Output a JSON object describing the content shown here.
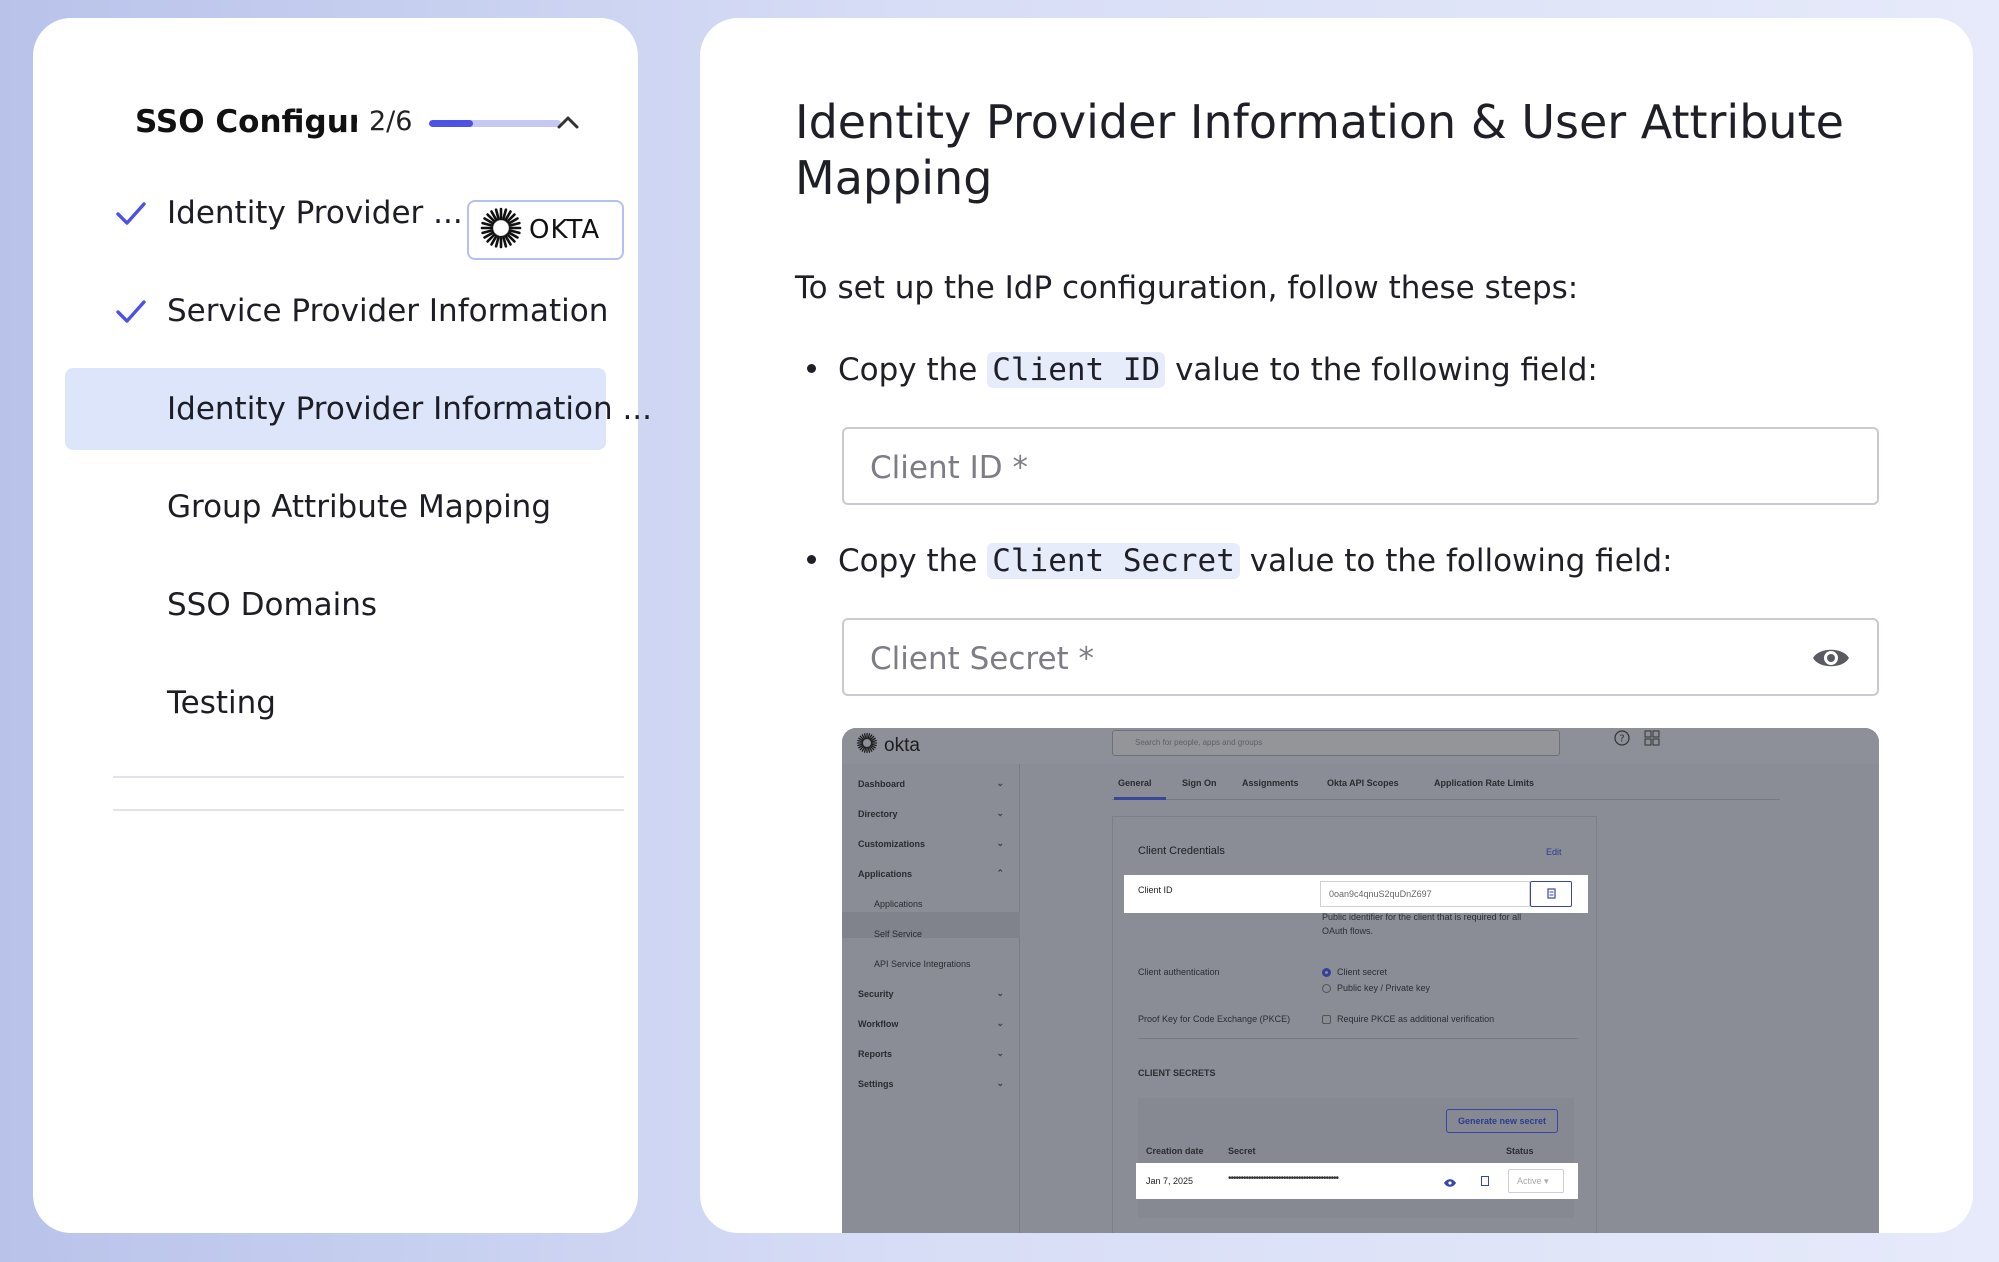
{
  "sidebar": {
    "title": "SSO Configuration",
    "progress_text": "2/6",
    "progress_fraction": 0.33,
    "steps": [
      {
        "label": "Identity Provider ...",
        "completed": true
      },
      {
        "label": "Service Provider Information",
        "completed": true
      },
      {
        "label": "Identity Provider Information ...",
        "completed": false,
        "active": true
      },
      {
        "label": "Group Attribute Mapping",
        "completed": false
      },
      {
        "label": "SSO Domains",
        "completed": false
      },
      {
        "label": "Testing",
        "completed": false
      }
    ],
    "provider_badge": "OKTA"
  },
  "main": {
    "heading": "Identity Provider Information & User Attribute Mapping",
    "intro": "To set up the IdP configuration, follow these steps:",
    "bullets": [
      {
        "before": "Copy the",
        "code": "Client ID",
        "after": "value to the following field:"
      },
      {
        "before": "Copy the",
        "code": "Client Secret",
        "after": "value to the following field:"
      }
    ],
    "client_id_field": {
      "placeholder": "Client ID *",
      "value": ""
    },
    "client_secret_field": {
      "placeholder": "Client Secret *",
      "value": ""
    }
  },
  "okta_screenshot": {
    "logo": "okta",
    "search_placeholder": "Search for people, apps and groups",
    "nav": [
      "Dashboard",
      "Directory",
      "Customizations",
      "Applications",
      "Security",
      "Workflow",
      "Reports",
      "Settings"
    ],
    "subnav": [
      "Applications",
      "Self Service",
      "API Service Integrations"
    ],
    "tabs": [
      "General",
      "Sign On",
      "Assignments",
      "Okta API Scopes",
      "Application Rate Limits"
    ],
    "card_title": "Client Credentials",
    "edit": "Edit",
    "client_id_label": "Client ID",
    "client_id_value": "0oan9c4qnuS2quDnZ697",
    "client_id_help": "Public identifier for the client that is required for all",
    "client_id_help2": "OAuth flows.",
    "client_auth_label": "Client authentication",
    "client_auth_opt1": "Client secret",
    "client_auth_opt2": "Public key / Private key",
    "pkce_label": "Proof Key for Code Exchange (PKCE)",
    "pkce_opt": "Require PKCE as additional verification",
    "secrets_heading": "CLIENT SECRETS",
    "generate_button": "Generate new secret",
    "col_date": "Creation date",
    "col_secret": "Secret",
    "col_status": "Status",
    "row_date": "Jan 7, 2025",
    "row_secret": "••••••••••••••••••••••••••••••••••••••••••••",
    "row_status": "Active ▾"
  }
}
